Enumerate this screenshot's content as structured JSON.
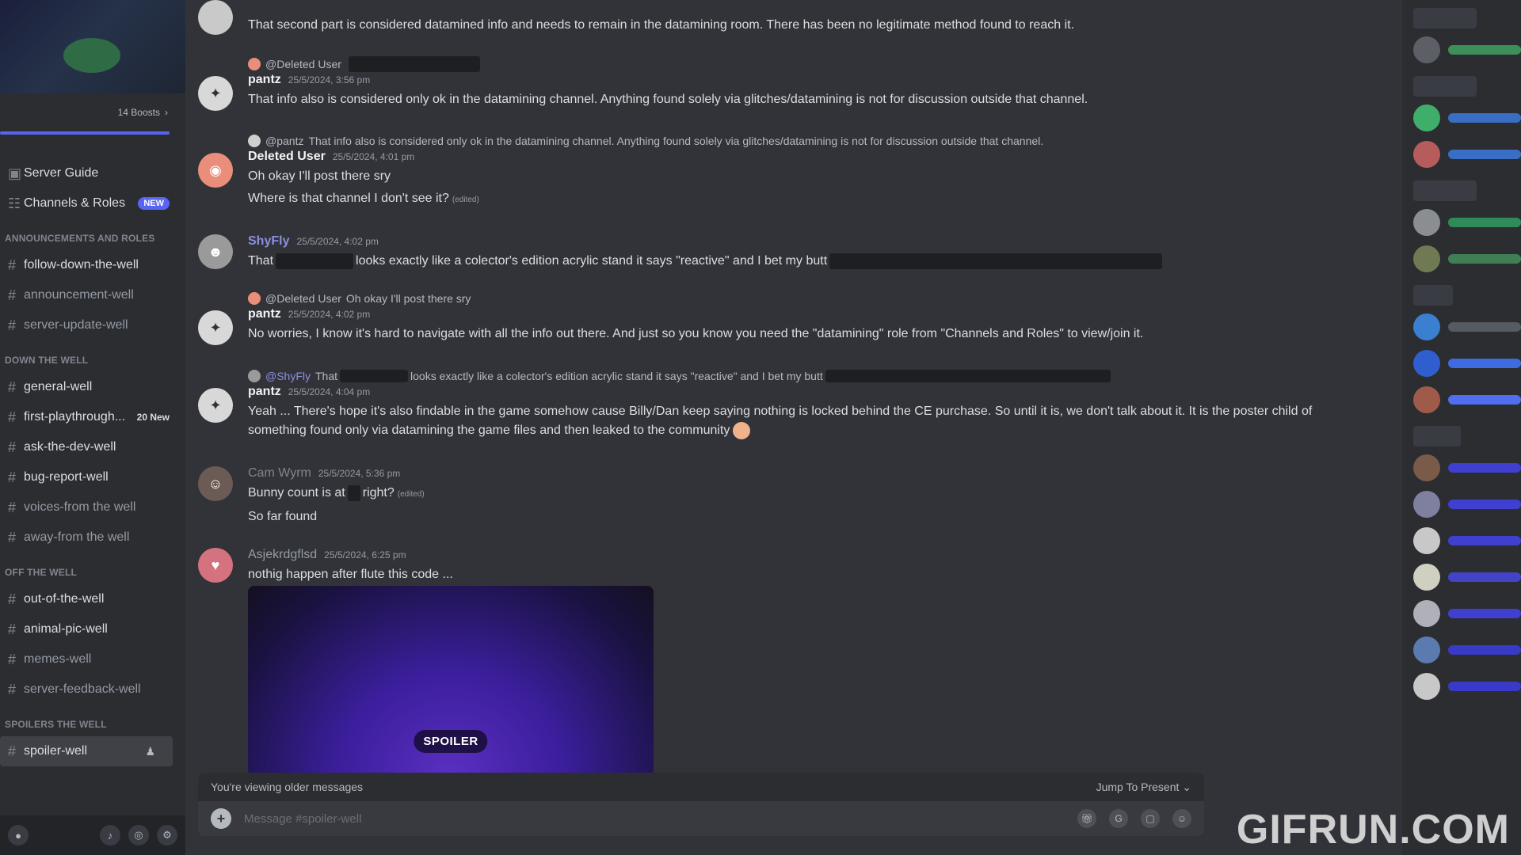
{
  "sidebar": {
    "boosts": "14 Boosts",
    "items_top": [
      {
        "label": "Server Guide",
        "badge": ""
      },
      {
        "label": "Channels & Roles",
        "badge": "NEW"
      }
    ],
    "categories": [
      {
        "title": "ANNOUNCEMENTS AND ROLES",
        "channels": [
          {
            "label": "follow-down-the-well",
            "badge": ""
          },
          {
            "label": "announcement-well",
            "badge": ""
          },
          {
            "label": "server-update-well",
            "badge": ""
          }
        ]
      },
      {
        "title": "DOWN THE WELL",
        "channels": [
          {
            "label": "general-well",
            "badge": ""
          },
          {
            "label": "first-playthrough...",
            "badge": "20 New"
          },
          {
            "label": "ask-the-dev-well",
            "badge": ""
          },
          {
            "label": "bug-report-well",
            "badge": ""
          },
          {
            "label": "voices-from the well",
            "badge": ""
          },
          {
            "label": "away-from the well",
            "badge": ""
          }
        ]
      },
      {
        "title": "OFF THE WELL",
        "channels": [
          {
            "label": "out-of-the-well",
            "badge": ""
          },
          {
            "label": "animal-pic-well",
            "badge": ""
          },
          {
            "label": "memes-well",
            "badge": ""
          },
          {
            "label": "server-feedback-well",
            "badge": ""
          }
        ]
      },
      {
        "title": "SPOILERS THE WELL",
        "channels": [
          {
            "label": "spoiler-well",
            "badge": ""
          }
        ]
      }
    ]
  },
  "messages": {
    "m0": {
      "text": "That second part is considered datamined info and needs to remain in the datamining room. There has been no legitimate method found to reach it."
    },
    "m1": {
      "reply_name": "@Deleted User",
      "author": "pantz",
      "ts": "25/5/2024, 3:56 pm",
      "text": "That info also is considered only ok in the datamining channel. Anything found solely via glitches/datamining is not for discussion outside that channel."
    },
    "m2": {
      "reply_name": "@pantz",
      "reply_text": "That info also is considered only ok in the datamining channel. Anything found solely via glitches/datamining is not for discussion outside that channel.",
      "author": "Deleted User",
      "ts": "25/5/2024, 4:01 pm",
      "line1": "Oh okay I'll post there sry",
      "line2": "Where is that channel I don't see it?",
      "edited": "(edited)"
    },
    "m3": {
      "author": "ShyFly",
      "ts": "25/5/2024, 4:02 pm",
      "pre": "That",
      "mid": "looks exactly like a colector's edition acrylic stand it says \"reactive\" and I bet my butt"
    },
    "m4": {
      "reply_name": "@Deleted User",
      "reply_text": "Oh okay I'll post there sry",
      "author": "pantz",
      "ts": "25/5/2024, 4:02 pm",
      "text": "No worries, I know it's hard to navigate with all the info out there. And just so you know you need the \"datamining\" role from \"Channels and Roles\" to view/join it."
    },
    "m5": {
      "reply_name": "@ShyFly",
      "reply_pre": "That",
      "reply_mid": "looks exactly like a colector's edition acrylic stand it says \"reactive\" and I bet my butt",
      "author": "pantz",
      "ts": "25/5/2024, 4:04 pm",
      "text": "Yeah ... There's hope it's also findable in the game somehow cause Billy/Dan keep saying nothing is locked behind the CE purchase. So until it is, we don't talk about it. It is the poster child of something found only via datamining the game files and then leaked to the community"
    },
    "m6": {
      "author": "Cam Wyrm",
      "ts": "25/5/2024, 5:36 pm",
      "pre": "Bunny count is at",
      "post": "right?",
      "edited": "(edited)",
      "line2": "So far found"
    },
    "m7": {
      "author": "Asjekrdgflsd",
      "ts": "25/5/2024, 6:25 pm",
      "text": "nothig happen after flute this code ...",
      "spoiler": "SPOILER"
    }
  },
  "composer": {
    "older": "You're viewing older messages",
    "jump": "Jump To Present",
    "placeholder": "Message #spoiler-well"
  },
  "colors": {
    "accent": "#5865f2",
    "shyfly": "#8c8fe0",
    "camwyrm": "#80848e"
  },
  "watermark": "GIFRUN.COM"
}
